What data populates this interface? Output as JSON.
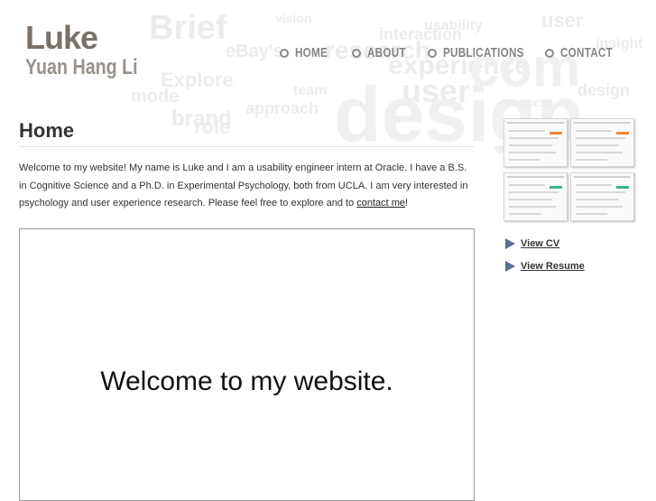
{
  "header": {
    "logo_first": "Luke",
    "logo_second": "Yuan Hang Li"
  },
  "nav": {
    "items": [
      {
        "label": "HOME"
      },
      {
        "label": "ABOUT"
      },
      {
        "label": "PUBLICATIONS"
      },
      {
        "label": "CONTACT"
      }
    ]
  },
  "background_words": [
    "Brief",
    "Explore",
    "eBay's",
    "approach",
    "user",
    "experience",
    "research",
    "design",
    "brand",
    "role",
    "team",
    "mode",
    "usability",
    "com",
    "interaction",
    "user",
    "process",
    "design",
    "vision",
    "insight"
  ],
  "main": {
    "title": "Home",
    "intro_text": "Welcome to my website! My name is Luke and I am a usability engineer intern at Oracle. I have a B.S. in Cognitive Science and a Ph.D. in Experimental Psychology, both from UCLA. I am very interested in psychology and user experience research. Please feel free to explore and to ",
    "intro_link": "contact me",
    "intro_end": "!",
    "video_text": "Welcome to my website."
  },
  "sidebar": {
    "links": [
      {
        "label": "View CV",
        "icon": "arrow-right-icon"
      },
      {
        "label": "View Resume",
        "icon": "arrow-right-icon"
      }
    ]
  },
  "colors": {
    "logo": "#7a7169",
    "nav": "#858585",
    "link_arrow": "#5b6e94",
    "thumb_accents": [
      "#e8893a",
      "#e8893a",
      "#3cb88a",
      "#3cb88a"
    ]
  }
}
